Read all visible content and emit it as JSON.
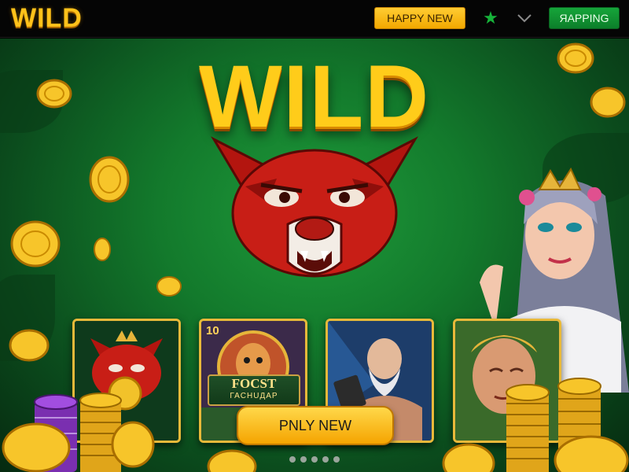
{
  "header": {
    "logo": "WILD",
    "promo_button": "HAPPY NEW",
    "favorite_icon": "star-icon",
    "dropdown_icon": "chevron-down-icon",
    "action_button": "ЯAPPING"
  },
  "hero": {
    "title": "WILD",
    "cta_button": "PNLY NEW"
  },
  "cards": [
    {
      "name": "red-beast-slot",
      "badge": "",
      "title": "",
      "subtitle": ""
    },
    {
      "name": "forest-slot",
      "badge": "10",
      "title": "FOCST",
      "subtitle": "ГАCHUДAP"
    },
    {
      "name": "old-wizard-slot",
      "badge": "",
      "title": "",
      "subtitle": ""
    },
    {
      "name": "greek-hero-slot",
      "badge": "",
      "title": "",
      "subtitle": ""
    }
  ],
  "carousel": {
    "pages": 5,
    "active": 0
  },
  "colors": {
    "accent_gold": "#ffc21a",
    "brand_green": "#16a53a",
    "background": "#000000"
  }
}
